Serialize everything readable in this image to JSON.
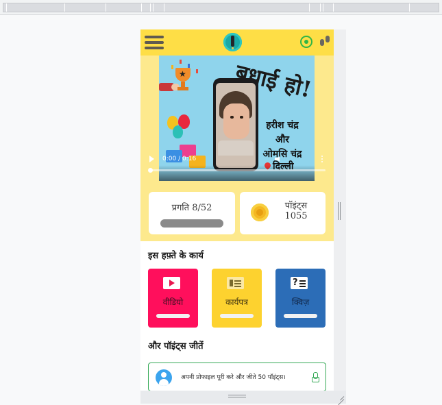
{
  "header": {
    "menu_icon": "hamburger-menu-icon",
    "logo_icon": "pencil-logo-icon",
    "whatsapp_icon": "whatsapp-icon",
    "steps_icon": "footsteps-icon",
    "background_color": "#fede46"
  },
  "video": {
    "banner_heading": "बधाई हो!",
    "name_line1": "हरीश चंद्र",
    "name_line2": "और",
    "name_line3": "ओमसि चंद्र",
    "location": "दिल्ली",
    "time_display": "0:00 / 0:16",
    "progress_fraction": 0.0
  },
  "stats": {
    "progress_label": "प्रगति 8/52",
    "progress_done": 8,
    "progress_total": 52,
    "points_label": "पॉइंट्स",
    "points_value": "1055"
  },
  "tasks_section": {
    "title": "इस हफ़्ते के कार्य",
    "cards": [
      {
        "label": "वीडियो",
        "icon": "video-play-icon",
        "color": "#ff0f5c",
        "text_color": "#3a1020"
      },
      {
        "label": "कार्यपत्र",
        "icon": "worksheet-icon",
        "color": "#fdd22f",
        "text_color": "#3a2f10"
      },
      {
        "label": "क्विज़",
        "icon": "quiz-icon",
        "color": "#2c6db7",
        "text_color": "#0f2240"
      }
    ]
  },
  "more_points": {
    "title": "और पॉइंट्स जीतें",
    "profile_text": "अपनी प्रोफाइल पूरी करे और जीते 50 पॉइंट्स।",
    "border_color": "#33a854"
  }
}
